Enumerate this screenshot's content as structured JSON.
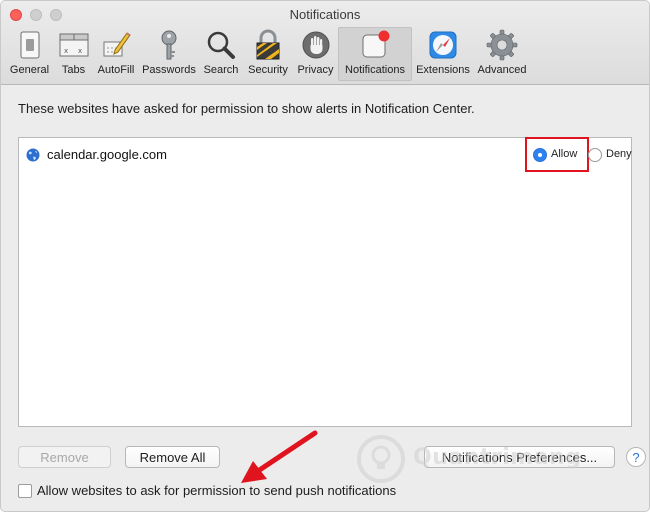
{
  "window": {
    "title": "Notifications"
  },
  "toolbar": {
    "items": [
      {
        "label": "General",
        "icon": "general-icon"
      },
      {
        "label": "Tabs",
        "icon": "tabs-icon"
      },
      {
        "label": "AutoFill",
        "icon": "autofill-icon"
      },
      {
        "label": "Passwords",
        "icon": "passwords-key-icon"
      },
      {
        "label": "Search",
        "icon": "search-icon"
      },
      {
        "label": "Security",
        "icon": "security-lock-icon"
      },
      {
        "label": "Privacy",
        "icon": "privacy-hand-icon"
      },
      {
        "label": "Notifications",
        "icon": "notifications-icon",
        "active": true
      },
      {
        "label": "Extensions",
        "icon": "extensions-compass-icon"
      },
      {
        "label": "Advanced",
        "icon": "advanced-gear-icon"
      }
    ]
  },
  "main": {
    "description": "These websites have asked for permission to show alerts in Notification Center.",
    "sites": [
      {
        "name": "calendar.google.com",
        "icon": "globe-icon",
        "allow_label": "Allow",
        "deny_label": "Deny",
        "selected": "Allow"
      }
    ]
  },
  "buttons": {
    "remove": "Remove",
    "remove_all": "Remove All",
    "notification_prefs": "Notifications Preferences...",
    "help": "?"
  },
  "push_checkbox": {
    "label": "Allow websites to ask for permission to send push notifications",
    "checked": false
  },
  "watermark": {
    "text": "Quantrimang"
  },
  "colors": {
    "accent": "#2e82f0",
    "highlight_box": "#e0141e",
    "arrow": "#e0141e",
    "close_button": "#fc605b"
  }
}
